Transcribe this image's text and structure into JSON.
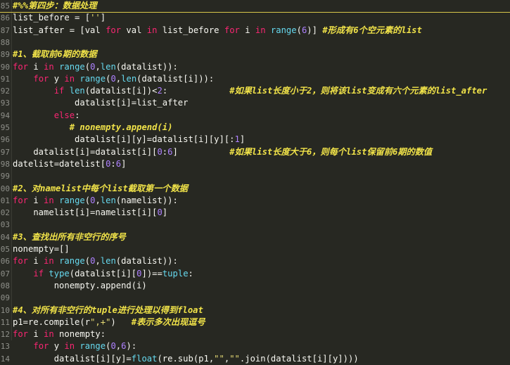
{
  "editor": {
    "lines": [
      {
        "n": "85",
        "tokens": [
          {
            "t": "#%%第四步：数据处理",
            "c": "com"
          }
        ]
      },
      {
        "n": "86",
        "tokens": [
          {
            "t": "list_before = [",
            "c": "plain"
          },
          {
            "t": "''",
            "c": "str"
          },
          {
            "t": "]",
            "c": "plain"
          }
        ]
      },
      {
        "n": "87",
        "tokens": [
          {
            "t": "list_after = [val ",
            "c": "plain"
          },
          {
            "t": "for",
            "c": "kw"
          },
          {
            "t": " val ",
            "c": "plain"
          },
          {
            "t": "in",
            "c": "kw"
          },
          {
            "t": " list_before ",
            "c": "plain"
          },
          {
            "t": "for",
            "c": "kw"
          },
          {
            "t": " i ",
            "c": "plain"
          },
          {
            "t": "in",
            "c": "kw"
          },
          {
            "t": " ",
            "c": "plain"
          },
          {
            "t": "range",
            "c": "fn"
          },
          {
            "t": "(",
            "c": "plain"
          },
          {
            "t": "6",
            "c": "num"
          },
          {
            "t": ")] ",
            "c": "plain"
          },
          {
            "t": "#形成有6个空元素的list",
            "c": "com"
          }
        ]
      },
      {
        "n": "88",
        "tokens": []
      },
      {
        "n": "89",
        "tokens": [
          {
            "t": "#1、截取前6期的数据",
            "c": "com"
          }
        ]
      },
      {
        "n": "90",
        "tokens": [
          {
            "t": "for",
            "c": "kw"
          },
          {
            "t": " i ",
            "c": "plain"
          },
          {
            "t": "in",
            "c": "kw"
          },
          {
            "t": " ",
            "c": "plain"
          },
          {
            "t": "range",
            "c": "fn"
          },
          {
            "t": "(",
            "c": "plain"
          },
          {
            "t": "0",
            "c": "num"
          },
          {
            "t": ",",
            "c": "plain"
          },
          {
            "t": "len",
            "c": "fn"
          },
          {
            "t": "(datalist)):",
            "c": "plain"
          }
        ]
      },
      {
        "n": "91",
        "tokens": [
          {
            "t": "    ",
            "c": "plain"
          },
          {
            "t": "for",
            "c": "kw"
          },
          {
            "t": " y ",
            "c": "plain"
          },
          {
            "t": "in",
            "c": "kw"
          },
          {
            "t": " ",
            "c": "plain"
          },
          {
            "t": "range",
            "c": "fn"
          },
          {
            "t": "(",
            "c": "plain"
          },
          {
            "t": "0",
            "c": "num"
          },
          {
            "t": ",",
            "c": "plain"
          },
          {
            "t": "len",
            "c": "fn"
          },
          {
            "t": "(datalist[i])):",
            "c": "plain"
          }
        ]
      },
      {
        "n": "92",
        "tokens": [
          {
            "t": "        ",
            "c": "plain"
          },
          {
            "t": "if",
            "c": "kw"
          },
          {
            "t": " ",
            "c": "plain"
          },
          {
            "t": "len",
            "c": "fn"
          },
          {
            "t": "(datalist[i])<",
            "c": "plain"
          },
          {
            "t": "2",
            "c": "num"
          },
          {
            "t": ":            ",
            "c": "plain"
          },
          {
            "t": "#如果list长度小于2，则将该list变成有六个元素的list_after",
            "c": "com"
          }
        ]
      },
      {
        "n": "93",
        "tokens": [
          {
            "t": "            datalist[i]=list_after",
            "c": "plain"
          }
        ]
      },
      {
        "n": "94",
        "tokens": [
          {
            "t": "        ",
            "c": "plain"
          },
          {
            "t": "else",
            "c": "kw"
          },
          {
            "t": ":",
            "c": "plain"
          }
        ]
      },
      {
        "n": "95",
        "tokens": [
          {
            "t": "           ",
            "c": "plain"
          },
          {
            "t": "# nonempty.append(i)",
            "c": "com"
          }
        ]
      },
      {
        "n": "96",
        "tokens": [
          {
            "t": "            datalist[i][y]=datalist[i][y][:",
            "c": "plain"
          },
          {
            "t": "1",
            "c": "num"
          },
          {
            "t": "]",
            "c": "plain"
          }
        ]
      },
      {
        "n": "97",
        "tokens": [
          {
            "t": "    datalist[i]=datalist[i][",
            "c": "plain"
          },
          {
            "t": "0",
            "c": "num"
          },
          {
            "t": ":",
            "c": "plain"
          },
          {
            "t": "6",
            "c": "num"
          },
          {
            "t": "]          ",
            "c": "plain"
          },
          {
            "t": "#如果list长度大于6，则每个list保留前6期的数值",
            "c": "com"
          }
        ]
      },
      {
        "n": "98",
        "tokens": [
          {
            "t": "datelist=datelist[",
            "c": "plain"
          },
          {
            "t": "0",
            "c": "num"
          },
          {
            "t": ":",
            "c": "plain"
          },
          {
            "t": "6",
            "c": "num"
          },
          {
            "t": "]",
            "c": "plain"
          }
        ]
      },
      {
        "n": "99",
        "tokens": []
      },
      {
        "n": "00",
        "tokens": [
          {
            "t": "#2、对namelist中每个list截取第一个数据",
            "c": "com"
          }
        ]
      },
      {
        "n": "01",
        "tokens": [
          {
            "t": "for",
            "c": "kw"
          },
          {
            "t": " i ",
            "c": "plain"
          },
          {
            "t": "in",
            "c": "kw"
          },
          {
            "t": " ",
            "c": "plain"
          },
          {
            "t": "range",
            "c": "fn"
          },
          {
            "t": "(",
            "c": "plain"
          },
          {
            "t": "0",
            "c": "num"
          },
          {
            "t": ",",
            "c": "plain"
          },
          {
            "t": "len",
            "c": "fn"
          },
          {
            "t": "(namelist)):",
            "c": "plain"
          }
        ]
      },
      {
        "n": "02",
        "tokens": [
          {
            "t": "    namelist[i]=namelist[i][",
            "c": "plain"
          },
          {
            "t": "0",
            "c": "num"
          },
          {
            "t": "]",
            "c": "plain"
          }
        ]
      },
      {
        "n": "03",
        "tokens": []
      },
      {
        "n": "04",
        "tokens": [
          {
            "t": "#3、查找出所有非空行的序号",
            "c": "com"
          }
        ]
      },
      {
        "n": "05",
        "tokens": [
          {
            "t": "nonempty=[]",
            "c": "plain"
          }
        ]
      },
      {
        "n": "06",
        "tokens": [
          {
            "t": "for",
            "c": "kw"
          },
          {
            "t": " i ",
            "c": "plain"
          },
          {
            "t": "in",
            "c": "kw"
          },
          {
            "t": " ",
            "c": "plain"
          },
          {
            "t": "range",
            "c": "fn"
          },
          {
            "t": "(",
            "c": "plain"
          },
          {
            "t": "0",
            "c": "num"
          },
          {
            "t": ",",
            "c": "plain"
          },
          {
            "t": "len",
            "c": "fn"
          },
          {
            "t": "(datalist)):",
            "c": "plain"
          }
        ]
      },
      {
        "n": "07",
        "tokens": [
          {
            "t": "    ",
            "c": "plain"
          },
          {
            "t": "if",
            "c": "kw"
          },
          {
            "t": " ",
            "c": "plain"
          },
          {
            "t": "type",
            "c": "fn"
          },
          {
            "t": "(datalist[i][",
            "c": "plain"
          },
          {
            "t": "0",
            "c": "num"
          },
          {
            "t": "])==",
            "c": "plain"
          },
          {
            "t": "tuple",
            "c": "fn"
          },
          {
            "t": ":",
            "c": "plain"
          }
        ]
      },
      {
        "n": "08",
        "tokens": [
          {
            "t": "        nonempty.append(i)",
            "c": "plain"
          }
        ]
      },
      {
        "n": "09",
        "tokens": []
      },
      {
        "n": "10",
        "tokens": [
          {
            "t": "#4、对所有非空行的tuple进行处理以得到float",
            "c": "com"
          }
        ]
      },
      {
        "n": "11",
        "tokens": [
          {
            "t": "p1=re.compile(r",
            "c": "plain"
          },
          {
            "t": "\",+\"",
            "c": "str"
          },
          {
            "t": ")   ",
            "c": "plain"
          },
          {
            "t": "#表示多次出现逗号",
            "c": "com"
          }
        ]
      },
      {
        "n": "12",
        "tokens": [
          {
            "t": "for",
            "c": "kw"
          },
          {
            "t": " i ",
            "c": "plain"
          },
          {
            "t": "in",
            "c": "kw"
          },
          {
            "t": " nonempty:",
            "c": "plain"
          }
        ]
      },
      {
        "n": "13",
        "tokens": [
          {
            "t": "    ",
            "c": "plain"
          },
          {
            "t": "for",
            "c": "kw"
          },
          {
            "t": " y ",
            "c": "plain"
          },
          {
            "t": "in",
            "c": "kw"
          },
          {
            "t": " ",
            "c": "plain"
          },
          {
            "t": "range",
            "c": "fn"
          },
          {
            "t": "(",
            "c": "plain"
          },
          {
            "t": "0",
            "c": "num"
          },
          {
            "t": ",",
            "c": "plain"
          },
          {
            "t": "6",
            "c": "num"
          },
          {
            "t": "):",
            "c": "plain"
          }
        ]
      },
      {
        "n": "14",
        "tokens": [
          {
            "t": "        datalist[i][y]=",
            "c": "plain"
          },
          {
            "t": "float",
            "c": "fn"
          },
          {
            "t": "(re.sub(p1,",
            "c": "plain"
          },
          {
            "t": "\"\"",
            "c": "str"
          },
          {
            "t": ",",
            "c": "plain"
          },
          {
            "t": "\"\"",
            "c": "str"
          },
          {
            "t": ".join(datalist[i][y])))",
            "c": "plain"
          }
        ]
      }
    ],
    "colors": {
      "background": "#272822",
      "keyword": "#f92672",
      "builtin": "#66d9ef",
      "number": "#ae81ff",
      "string": "#e6db74",
      "comment": "#f1e349",
      "text": "#f8f8f2"
    }
  }
}
